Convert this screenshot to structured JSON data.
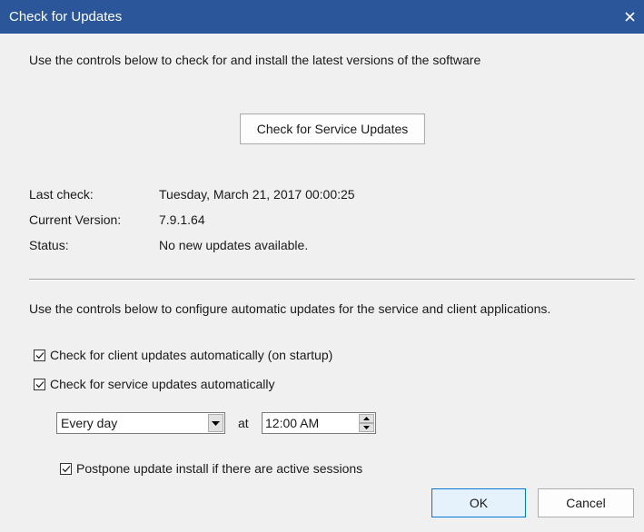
{
  "window": {
    "title": "Check for Updates",
    "titlebar_color": "#2b579a"
  },
  "intro_text": "Use the controls below to check for and install the latest versions of the software",
  "check_button_label": "Check for Service Updates",
  "info": {
    "last_check_label": "Last check:",
    "last_check_value": "Tuesday, March 21, 2017 00:00:25",
    "version_label": "Current Version:",
    "version_value": "7.9.1.64",
    "status_label": "Status:",
    "status_value": "No new updates available."
  },
  "auto_text": "Use the controls below to configure automatic updates for the service and client applications.",
  "options": {
    "client_updates": {
      "label": "Check for client updates automatically (on startup)",
      "checked": true
    },
    "service_updates": {
      "label": "Check for service updates automatically",
      "checked": true
    },
    "postpone": {
      "label": "Postpone update install if there are active sessions",
      "checked": true
    }
  },
  "schedule": {
    "frequency": "Every day",
    "at_label": "at",
    "time": "12:00 AM"
  },
  "buttons": {
    "ok": "OK",
    "cancel": "Cancel"
  },
  "icons": {
    "close": "close-icon",
    "checkmark": "checkmark-icon",
    "dropdown": "chevron-down-icon",
    "spin_up": "triangle-up-icon",
    "spin_down": "triangle-down-icon"
  }
}
